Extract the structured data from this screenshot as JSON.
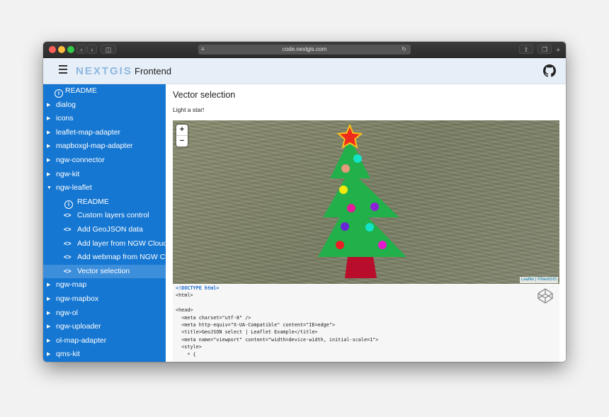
{
  "browser": {
    "url": "code.nextgis.com"
  },
  "header": {
    "logo": "NEXTGIS",
    "title": "Frontend"
  },
  "sidebar": {
    "items": [
      {
        "label": "README",
        "type": "info"
      },
      {
        "label": "dialog"
      },
      {
        "label": "icons"
      },
      {
        "label": "leaflet-map-adapter"
      },
      {
        "label": "mapboxgl-map-adapter"
      },
      {
        "label": "ngw-connector"
      },
      {
        "label": "ngw-kit"
      },
      {
        "label": "ngw-leaflet",
        "expanded": true
      },
      {
        "label": "README",
        "type": "info",
        "child": true
      },
      {
        "label": "Custom layers control",
        "type": "code",
        "child": true
      },
      {
        "label": "Add GeoJSON data",
        "type": "code",
        "child": true
      },
      {
        "label": "Add layer from NGW Cloud",
        "type": "code",
        "child": true
      },
      {
        "label": "Add webmap from NGW Cloud",
        "type": "code",
        "child": true
      },
      {
        "label": "Vector selection",
        "type": "code",
        "child": true,
        "active": true
      },
      {
        "label": "ngw-map"
      },
      {
        "label": "ngw-mapbox"
      },
      {
        "label": "ngw-ol"
      },
      {
        "label": "ngw-uploader"
      },
      {
        "label": "ol-map-adapter"
      },
      {
        "label": "qms-kit"
      }
    ]
  },
  "main": {
    "title": "Vector selection",
    "subtitle": "Light a star!",
    "map": {
      "zoom_in": "+",
      "zoom_out": "−",
      "attribution_leaflet": "Leaflet",
      "attribution_sep": " | ",
      "attribution_owner": "©NextGIS"
    },
    "code": [
      "<!DOCTYPE html>",
      "<html>",
      "",
      "<head>",
      "  <meta charset=\"utf-8\" />",
      "  <meta http-equiv=\"X-UA-Compatible\" content=\"IE=edge\">",
      "  <title>GeoJSON select | Leaflet Example</title>",
      "  <meta name=\"viewport\" content=\"width=device-width, initial-scale=1\">",
      "  <style>",
      "    * {"
    ]
  },
  "colors": {
    "sidebar": "#1677d2",
    "sidebar_active": "#3e8fdb",
    "tree": "#22b04a",
    "trunk": "#b80d2b",
    "star_fill": "#ee2a1c",
    "star_stroke": "#f6c21b"
  }
}
